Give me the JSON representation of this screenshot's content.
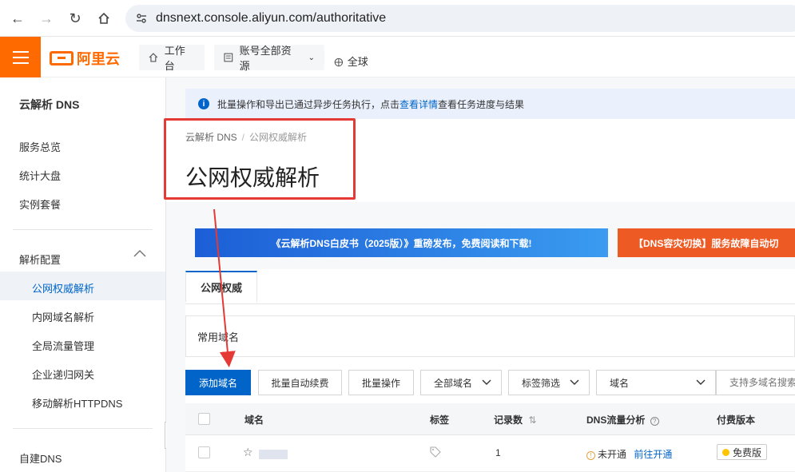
{
  "browser": {
    "url": "dnsnext.console.aliyun.com/authoritative"
  },
  "topbar": {
    "logo_text": "阿里云",
    "workbench_label": "工作台",
    "resources_label": "账号全部资源",
    "region_label": "全球"
  },
  "sidebar": {
    "title": "云解析 DNS",
    "items": [
      {
        "label": "服务总览"
      },
      {
        "label": "统计大盘"
      },
      {
        "label": "实例套餐"
      }
    ],
    "group_label": "解析配置",
    "sub_items": [
      {
        "label": "公网权威解析",
        "active": true
      },
      {
        "label": "内网域名解析"
      },
      {
        "label": "全局流量管理"
      },
      {
        "label": "企业递归网关"
      },
      {
        "label": "移动解析HTTPDNS"
      }
    ],
    "bottom_item": "自建DNS"
  },
  "notice": {
    "text_before": "批量操作和导出已通过异步任务执行，点击",
    "link": "查看详情",
    "text_after": "查看任务进度与结果"
  },
  "breadcrumb": {
    "root": "云解析 DNS",
    "current": "公网权威解析"
  },
  "page_title": "公网权威解析",
  "banners": {
    "left": "《云解析DNS白皮书（2025版）》重磅发布，免费阅读和下载!",
    "right": "【DNS容灾切换】服务故障自动切"
  },
  "tabs": [
    {
      "label": "公网权威"
    }
  ],
  "favorites_label": "常用域名",
  "toolbar": {
    "add_domain": "添加域名",
    "auto_renew": "批量自动续费",
    "batch_ops": "批量操作",
    "all_domains": "全部域名",
    "tag_filter": "标签筛选",
    "field_select": "域名",
    "search_placeholder": "支持多域名搜索"
  },
  "table": {
    "headers": {
      "domain": "域名",
      "tags": "标签",
      "records": "记录数",
      "dns_analysis": "DNS流量分析",
      "edition": "付费版本"
    },
    "rows": [
      {
        "records": "1",
        "analysis_status": "未开通",
        "analysis_link": "前往开通",
        "edition": "免费版"
      }
    ]
  },
  "colors": {
    "brand": "#ff6a00",
    "primary": "#0064c8",
    "annotation": "#e53935"
  }
}
